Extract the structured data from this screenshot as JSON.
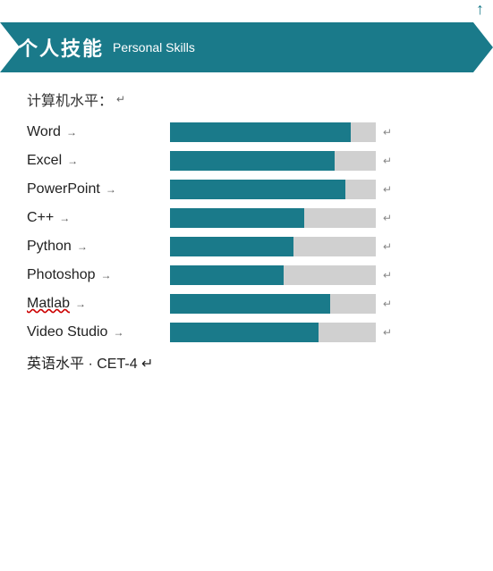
{
  "header": {
    "icon": "↑",
    "title": "个人技能",
    "subtitle": "Personal Skills",
    "arrows": "←→"
  },
  "subsection": {
    "label": "计算机水平：",
    "return_arrow": "↵"
  },
  "skills": [
    {
      "name": "Word",
      "percent": 88,
      "has_arrow": true,
      "underline": false
    },
    {
      "name": "Excel",
      "percent": 80,
      "has_arrow": true,
      "underline": false
    },
    {
      "name": "PowerPoint",
      "percent": 85,
      "has_arrow": true,
      "underline": false
    },
    {
      "name": "C++",
      "percent": 65,
      "has_arrow": true,
      "underline": false
    },
    {
      "name": "Python",
      "percent": 60,
      "has_arrow": true,
      "underline": false
    },
    {
      "name": "Photoshop",
      "percent": 55,
      "has_arrow": true,
      "underline": false
    },
    {
      "name": "Matlab",
      "percent": 78,
      "has_arrow": true,
      "underline": true
    },
    {
      "name": "Video Studio",
      "percent": 72,
      "has_arrow": true,
      "underline": false
    }
  ],
  "english_level": {
    "label": "英语水平",
    "detail": "· CET-4",
    "return_arrow": "↵"
  },
  "colors": {
    "header_bg": "#1a7a8a",
    "bar_fill": "#1a7a8a",
    "bar_empty": "#d0d0d0",
    "text_primary": "#222222",
    "text_secondary": "#666666"
  }
}
